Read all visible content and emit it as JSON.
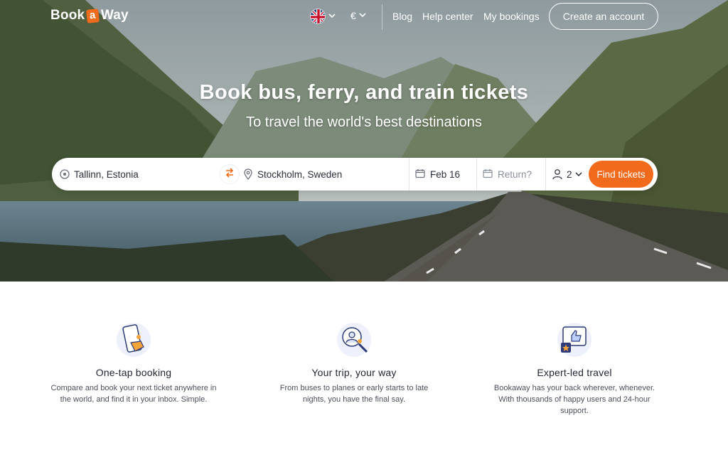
{
  "brand": {
    "logo_prefix": "Book",
    "logo_mid": "a",
    "logo_suffix": "Way"
  },
  "header": {
    "language_icon": "uk-flag-icon",
    "currency": "€",
    "nav": {
      "blog": "Blog",
      "help": "Help center",
      "bookings": "My bookings"
    },
    "create_account": "Create an account"
  },
  "hero": {
    "title": "Book bus, ferry, and train tickets",
    "subtitle": "To travel the world's best destinations"
  },
  "search": {
    "from": "Tallinn, Estonia",
    "to": "Stockholm, Sweden",
    "depart": "Feb 16",
    "return_placeholder": "Return?",
    "passengers": "2",
    "submit": "Find tickets"
  },
  "features": [
    {
      "icon": "phone-tap-icon",
      "title": "One-tap booking",
      "text": "Compare and book your next ticket anywhere in the world, and find it in your inbox. Simple."
    },
    {
      "icon": "magnifier-person-icon",
      "title": "Your trip, your way",
      "text": "From buses to planes or early starts to late nights, you have the final say."
    },
    {
      "icon": "thumbs-up-chat-icon",
      "title": "Expert-led travel",
      "text": "Bookaway has your back wherever, whenever. With thousands of happy users and 24-hour support."
    }
  ],
  "colors": {
    "accent": "#f26b1d",
    "text": "#1f2430"
  }
}
